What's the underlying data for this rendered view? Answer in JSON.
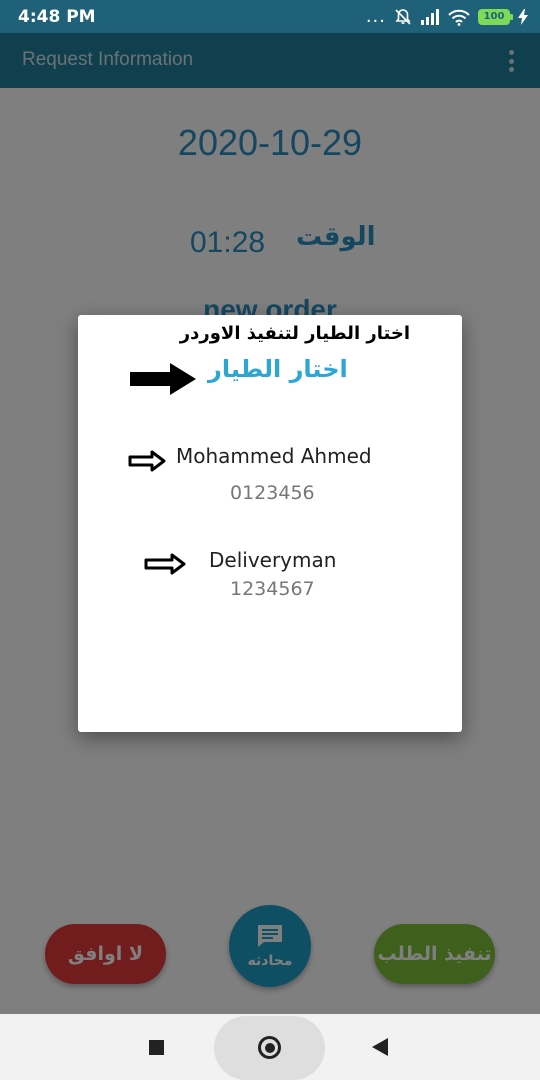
{
  "status_bar": {
    "time": "4:48 PM",
    "dots": "...",
    "battery": "100"
  },
  "app_bar": {
    "title": "Request Information"
  },
  "request": {
    "date": "2020-10-29",
    "time_label": "الوقت",
    "time_value": "01:28",
    "status": "new order"
  },
  "actions": {
    "reject_label": "لا اوافق",
    "chat_label": "محادثه",
    "execute_label": "تنفيذ الطلب"
  },
  "dialog": {
    "annotation": "اختار الطيار لتنفيذ الاوردر",
    "title": "اختار الطيار",
    "pilots": [
      {
        "name": "Mohammed Ahmed",
        "phone": "0123456"
      },
      {
        "name": "Deliveryman",
        "phone": "1234567"
      }
    ]
  },
  "colors": {
    "status_bar": "#1f6179",
    "app_bar": "#207f9d",
    "accent_text": "#2b8fc0",
    "dialog_title": "#2ba7d6",
    "reject": "#e53b3b",
    "execute": "#7fbf3a",
    "chat": "#1f9ec7"
  }
}
